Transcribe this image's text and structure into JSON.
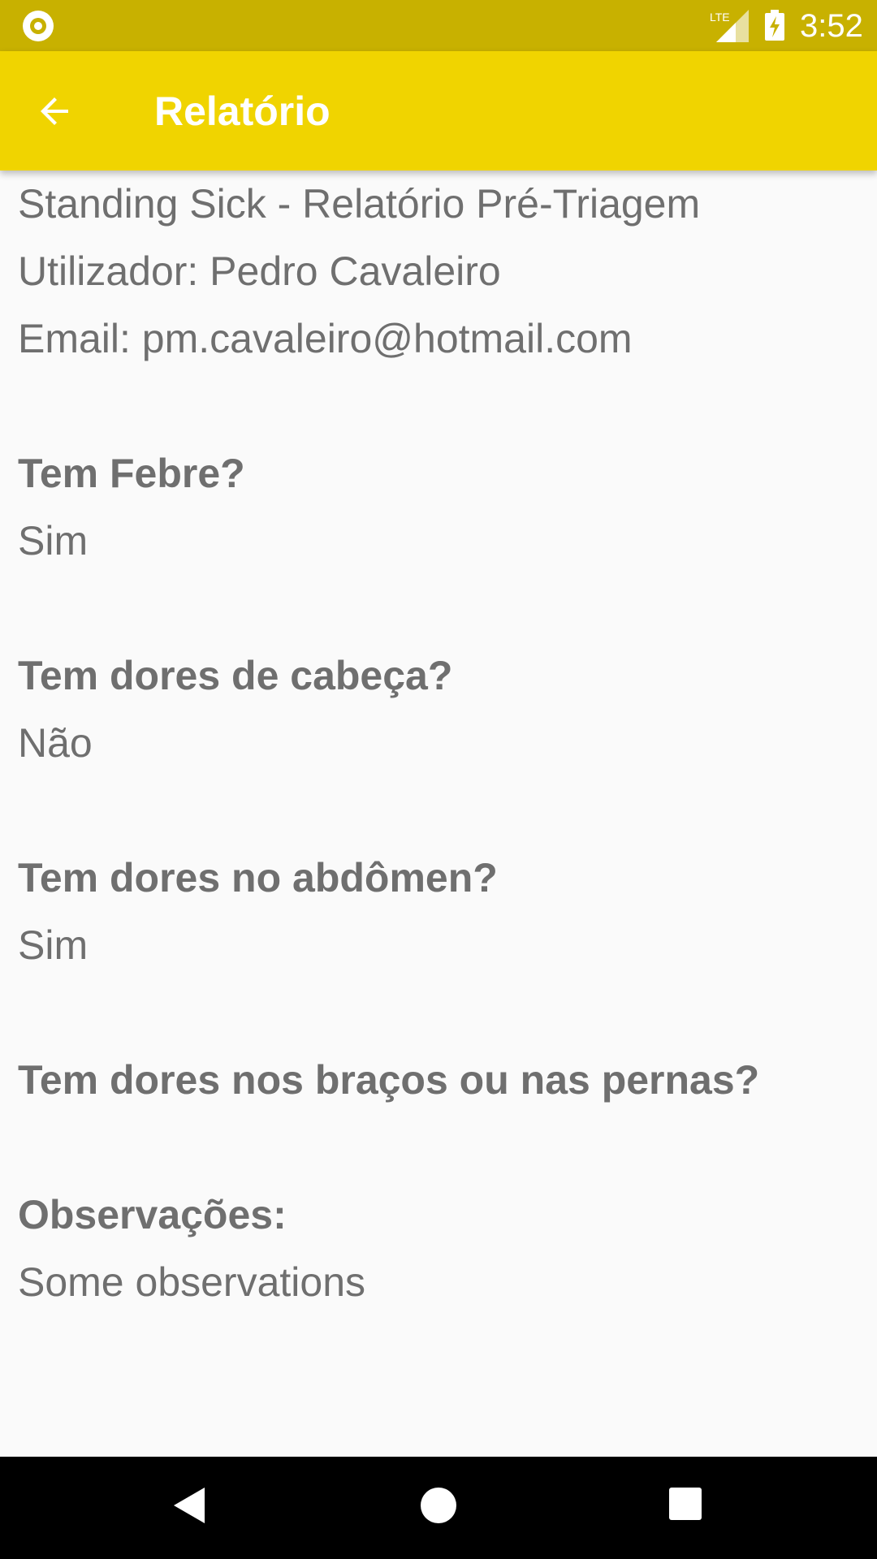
{
  "status_bar": {
    "time": "3:52",
    "network_label": "LTE",
    "bar_color": "#c8b100"
  },
  "toolbar": {
    "title": "Relatório",
    "back_icon": "arrow-left-icon",
    "bar_color": "#f0d400"
  },
  "report": {
    "header_title": "Standing Sick - Relatório Pré-Triagem",
    "user_line": "Utilizador: Pedro Cavaleiro",
    "email_line": "Email: pm.cavaleiro@hotmail.com",
    "questions": [
      {
        "question": "Tem Febre?",
        "answer": "Sim"
      },
      {
        "question": "Tem dores de cabeça?",
        "answer": "Não"
      },
      {
        "question": "Tem dores no abdômen?",
        "answer": "Sim"
      },
      {
        "question": "Tem dores nos braços ou nas pernas?",
        "answer": ""
      }
    ],
    "observations_label": "Observações:",
    "observations_text": "Some observations"
  },
  "nav_bar": {
    "back_icon": "triangle-back-icon",
    "home_icon": "circle-home-icon",
    "recents_icon": "square-recents-icon"
  }
}
